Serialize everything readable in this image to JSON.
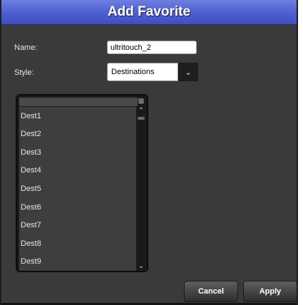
{
  "dialog": {
    "title": "Add Favorite"
  },
  "form": {
    "name_label": "Name:",
    "name_value": "ultritouch_2",
    "style_label": "Style:",
    "style_value": "Destinations"
  },
  "list": {
    "items": [
      "Dest1",
      "Dest2",
      "Dest3",
      "Dest4",
      "Dest5",
      "Dest6",
      "Dest7",
      "Dest8",
      "Dest9"
    ]
  },
  "buttons": {
    "cancel": "Cancel",
    "apply": "Apply"
  },
  "icons": {
    "dropdown": "chevron-down-icon",
    "header": "add-column-icon",
    "scroll_up": "chevron-up-icon",
    "scroll_down": "chevron-down-icon"
  },
  "colors": {
    "titlebar": "#4d5ed0",
    "background": "#3a3a3a"
  }
}
